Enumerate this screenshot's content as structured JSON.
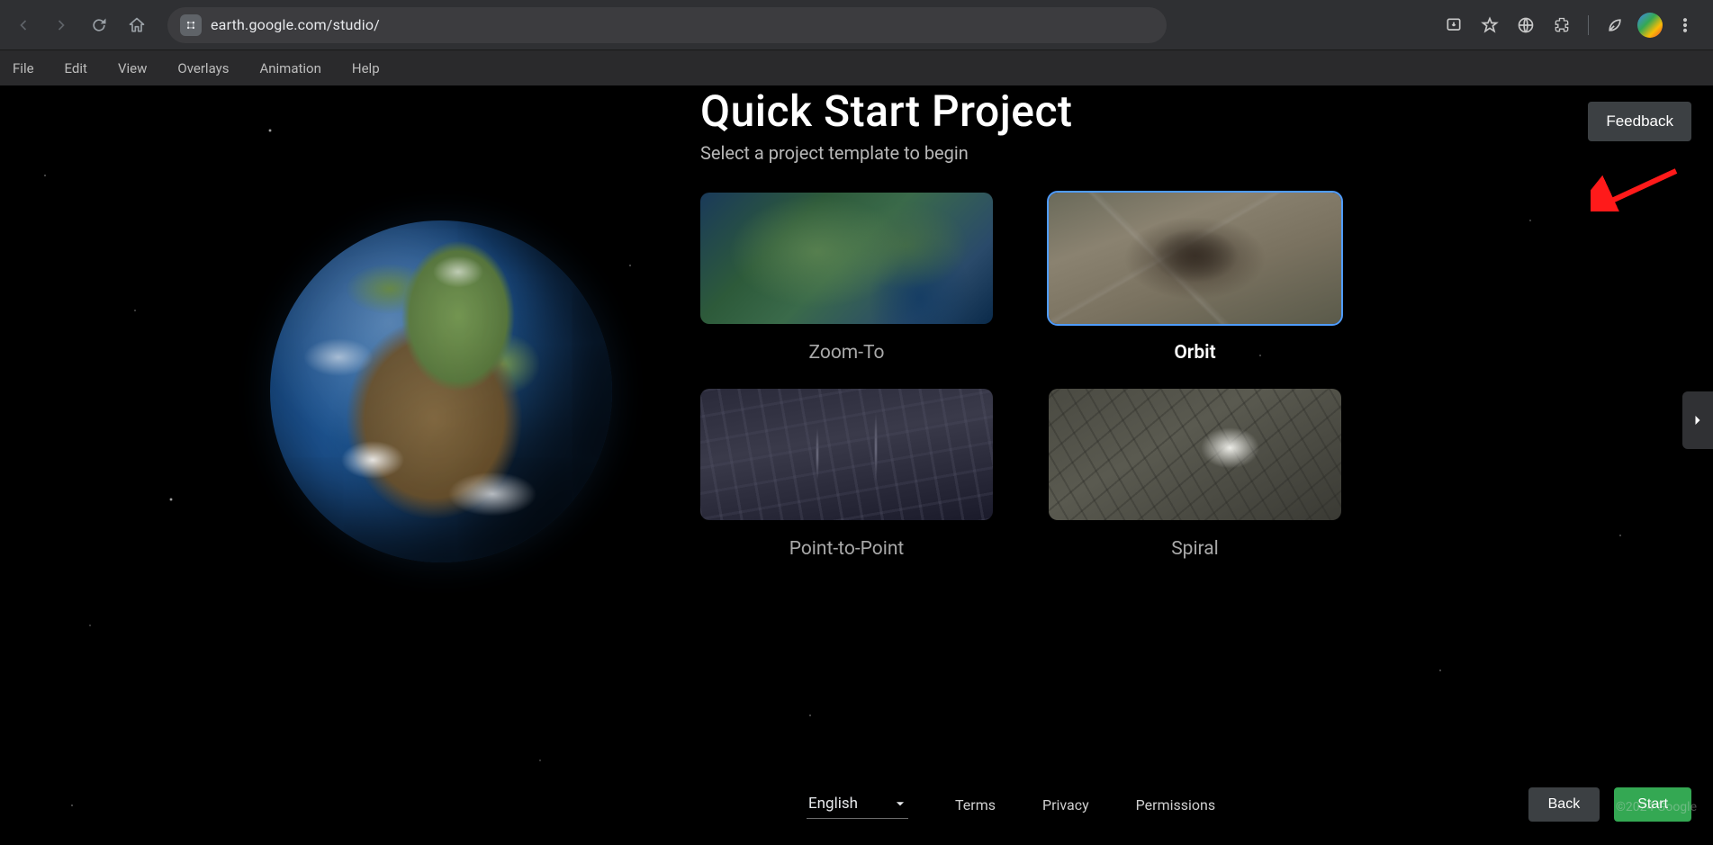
{
  "browser": {
    "url": "earth.google.com/studio/"
  },
  "menubar": {
    "items": [
      "File",
      "Edit",
      "View",
      "Overlays",
      "Animation",
      "Help"
    ]
  },
  "header": {
    "title": "Quick Start Project",
    "subtitle": "Select a project template to begin",
    "feedback": "Feedback"
  },
  "templates": [
    {
      "label": "Zoom-To",
      "selected": false,
      "thumbClass": "thumb-zoom"
    },
    {
      "label": "Orbit",
      "selected": true,
      "thumbClass": "thumb-orbit"
    },
    {
      "label": "Point-to-Point",
      "selected": false,
      "thumbClass": "thumb-ptp"
    },
    {
      "label": "Spiral",
      "selected": false,
      "thumbClass": "thumb-spiral"
    }
  ],
  "footer": {
    "language": "English",
    "links": [
      "Terms",
      "Privacy",
      "Permissions"
    ],
    "back": "Back",
    "start": "Start",
    "copyright": "©2024 Google"
  }
}
